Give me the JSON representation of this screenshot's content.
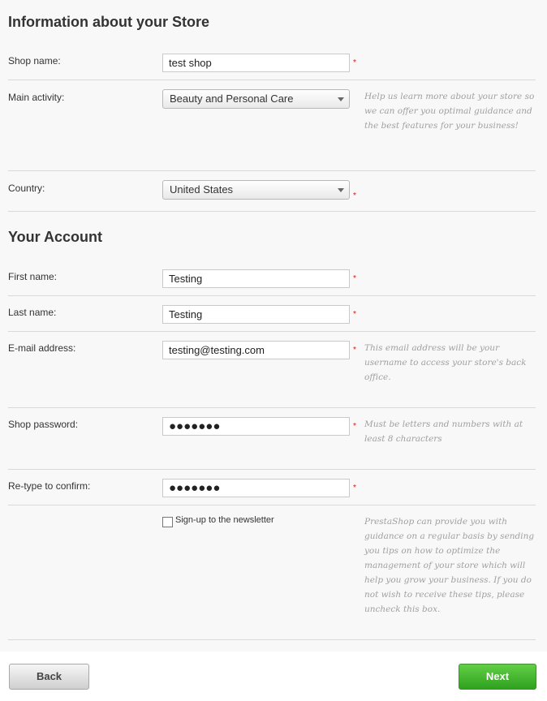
{
  "store_section": {
    "title": "Information about your Store",
    "shop_name_label": "Shop name:",
    "shop_name_value": "test shop",
    "main_activity_label": "Main activity:",
    "main_activity_value": "Beauty and Personal Care",
    "main_activity_help": "Help us learn more about your store so we can offer you optimal guidance and the best features for your business!",
    "country_label": "Country:",
    "country_value": "United States"
  },
  "account_section": {
    "title": "Your Account",
    "first_name_label": "First name:",
    "first_name_value": "Testing",
    "last_name_label": "Last name:",
    "last_name_value": "Testing",
    "email_label": "E-mail address:",
    "email_value": "testing@testing.com",
    "email_help": "This email address will be your username to access your store's back office.",
    "password_label": "Shop password:",
    "password_value": "●●●●●●●",
    "password_help": "Must be letters and numbers with at least 8 characters",
    "confirm_label": "Re-type to confirm:",
    "confirm_value": "●●●●●●●",
    "newsletter_label": "Sign-up to the newsletter",
    "newsletter_checked": false,
    "newsletter_help": "PrestaShop can provide you with guidance on a regular basis by sending you tips on how to optimize the management of your store which will help you grow your business. If you do not wish to receive these tips, please uncheck this box."
  },
  "required_marker": "*",
  "buttons": {
    "back": "Back",
    "next": "Next"
  },
  "colors": {
    "panel_bg": "#f8f8f8",
    "required": "#dd1111",
    "help_text": "#a0a0a0",
    "next_button": "#3fb02c"
  }
}
